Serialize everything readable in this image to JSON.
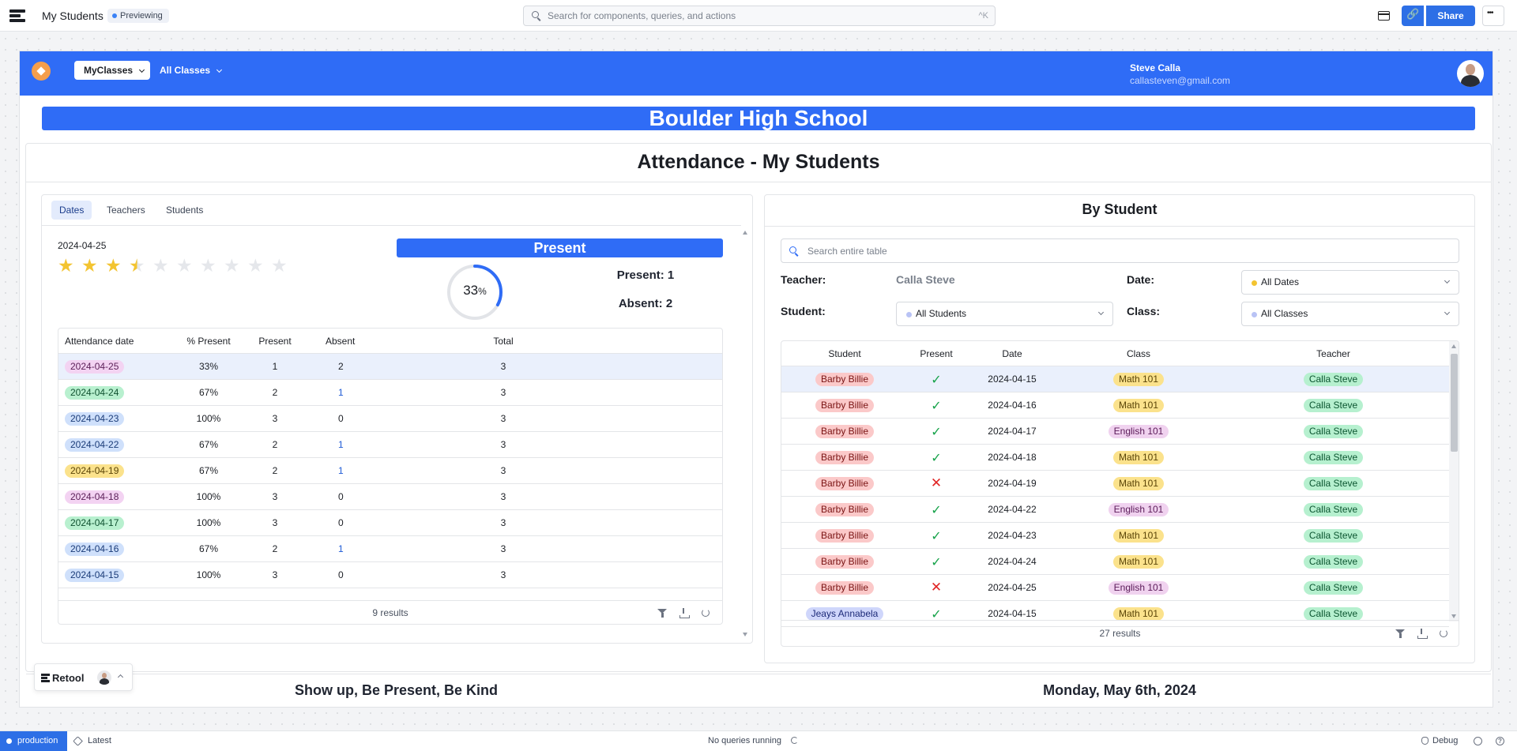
{
  "topbar": {
    "app_title": "My Students",
    "mode_badge": "Previewing",
    "search_placeholder": "Search for components, queries, and actions",
    "search_shortcut": "^K",
    "share_label": "Share"
  },
  "app_header": {
    "nav_myclasses": "MyClasses",
    "nav_allclasses": "All Classes",
    "user_name": "Steve Calla",
    "user_email": "callasteven@gmail.com"
  },
  "school_name": "Boulder High School",
  "page_title": "Attendance - My Students",
  "left_panel": {
    "tabs": [
      {
        "label": "Dates",
        "active": true
      },
      {
        "label": "Teachers",
        "active": false
      },
      {
        "label": "Students",
        "active": false
      }
    ],
    "selected_date": "2024-04-25",
    "rating": 3.5,
    "rating_max": 10,
    "present_banner": "Present",
    "percent_present": 33,
    "percent_symbol": "%",
    "present_stat": "Present: 1",
    "absent_stat": "Absent: 2",
    "table": {
      "columns": [
        "Attendance date",
        "% Present",
        "Present",
        "Absent",
        "Total"
      ],
      "rows": [
        {
          "date": "2024-04-25",
          "pct": "33%",
          "present": "1",
          "absent": "2",
          "total": "3",
          "color": "pink"
        },
        {
          "date": "2024-04-24",
          "pct": "67%",
          "present": "2",
          "absent": "1",
          "total": "3",
          "color": "green"
        },
        {
          "date": "2024-04-23",
          "pct": "100%",
          "present": "3",
          "absent": "0",
          "total": "3",
          "color": "blue"
        },
        {
          "date": "2024-04-22",
          "pct": "67%",
          "present": "2",
          "absent": "1",
          "total": "3",
          "color": "blue"
        },
        {
          "date": "2024-04-19",
          "pct": "67%",
          "present": "2",
          "absent": "1",
          "total": "3",
          "color": "yellow"
        },
        {
          "date": "2024-04-18",
          "pct": "100%",
          "present": "3",
          "absent": "0",
          "total": "3",
          "color": "pink"
        },
        {
          "date": "2024-04-17",
          "pct": "100%",
          "present": "3",
          "absent": "0",
          "total": "3",
          "color": "green"
        },
        {
          "date": "2024-04-16",
          "pct": "67%",
          "present": "2",
          "absent": "1",
          "total": "3",
          "color": "blue"
        },
        {
          "date": "2024-04-15",
          "pct": "100%",
          "present": "3",
          "absent": "0",
          "total": "3",
          "color": "blue"
        }
      ],
      "results": "9 results"
    }
  },
  "right_panel": {
    "title": "By Student",
    "search_placeholder": "Search entire table",
    "teacher_label": "Teacher:",
    "teacher_value": "Calla Steve",
    "date_label": "Date:",
    "date_value": "All Dates",
    "student_label": "Student:",
    "student_value": "All Students",
    "class_label": "Class:",
    "class_value": "All Classes",
    "table": {
      "columns": [
        "Student",
        "Present",
        "Date",
        "Class",
        "Teacher"
      ],
      "rows": [
        {
          "student": "Barby Billie",
          "present": true,
          "date": "2024-04-15",
          "class": "Math 101",
          "teacher": "Calla Steve"
        },
        {
          "student": "Barby Billie",
          "present": true,
          "date": "2024-04-16",
          "class": "Math 101",
          "teacher": "Calla Steve"
        },
        {
          "student": "Barby Billie",
          "present": true,
          "date": "2024-04-17",
          "class": "English 101",
          "teacher": "Calla Steve"
        },
        {
          "student": "Barby Billie",
          "present": true,
          "date": "2024-04-18",
          "class": "Math 101",
          "teacher": "Calla Steve"
        },
        {
          "student": "Barby Billie",
          "present": false,
          "date": "2024-04-19",
          "class": "Math 101",
          "teacher": "Calla Steve"
        },
        {
          "student": "Barby Billie",
          "present": true,
          "date": "2024-04-22",
          "class": "English 101",
          "teacher": "Calla Steve"
        },
        {
          "student": "Barby Billie",
          "present": true,
          "date": "2024-04-23",
          "class": "Math 101",
          "teacher": "Calla Steve"
        },
        {
          "student": "Barby Billie",
          "present": true,
          "date": "2024-04-24",
          "class": "Math 101",
          "teacher": "Calla Steve"
        },
        {
          "student": "Barby Billie",
          "present": false,
          "date": "2024-04-25",
          "class": "English 101",
          "teacher": "Calla Steve"
        },
        {
          "student": "Jeays Annabela",
          "present": true,
          "date": "2024-04-15",
          "class": "Math 101",
          "teacher": "Calla Steve"
        }
      ],
      "results": "27 results"
    }
  },
  "footer": {
    "motto": "Show up, Be Present, Be Kind",
    "today": "Monday, May 6th, 2024"
  },
  "retool_chip": {
    "label": "Retool"
  },
  "statusbar": {
    "environment": "production",
    "version": "Latest",
    "queries": "No queries running",
    "debug": "Debug"
  },
  "colors": {
    "brand_blue": "#2f6cf6",
    "share_blue": "#2d6fe6",
    "star_gold": "#f3c431",
    "check_green": "#17a34a",
    "cross_red": "#e02424",
    "class_math": "#fbe28c",
    "class_english": "#f0d2ef",
    "teacher_tag": "#b6f0cf",
    "student_barby": "#fbc9c9",
    "student_jeays": "#cfd6fb"
  },
  "icons": [
    "retool-logo-icon",
    "search-icon",
    "preview-icon",
    "link-icon",
    "more-icon",
    "chevron-down-icon",
    "star-icon",
    "filter-icon",
    "download-icon",
    "refresh-icon",
    "check-icon",
    "cross-icon",
    "tag-icon",
    "sync-icon",
    "bug-icon",
    "history-icon",
    "help-icon"
  ]
}
